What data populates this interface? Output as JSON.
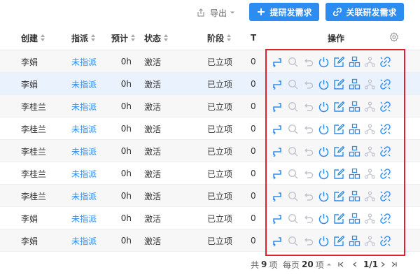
{
  "toolbar": {
    "export_label": "导出",
    "create_label": "提研发需求",
    "link_label": "关联研发需求"
  },
  "table": {
    "headers": {
      "creator": "创建",
      "assign": "指派",
      "estimate": "预计",
      "status": "状态",
      "stage": "阶段",
      "t": "T",
      "actions": "操作"
    },
    "rows": [
      {
        "creator": "李娟",
        "assign": "未指派",
        "estimate": "0h",
        "status": "激活",
        "stage": "已立项",
        "t": "0"
      },
      {
        "creator": "李娟",
        "assign": "未指派",
        "estimate": "0h",
        "status": "激活",
        "stage": "已立项",
        "t": "0"
      },
      {
        "creator": "李桂兰",
        "assign": "未指派",
        "estimate": "0h",
        "status": "激活",
        "stage": "已立项",
        "t": "0"
      },
      {
        "creator": "李桂兰",
        "assign": "未指派",
        "estimate": "0h",
        "status": "激活",
        "stage": "已立项",
        "t": "0"
      },
      {
        "creator": "李桂兰",
        "assign": "未指派",
        "estimate": "0h",
        "status": "激活",
        "stage": "已立项",
        "t": "0"
      },
      {
        "creator": "李桂兰",
        "assign": "未指派",
        "estimate": "0h",
        "status": "激活",
        "stage": "已立项",
        "t": "0"
      },
      {
        "creator": "李桂兰",
        "assign": "未指派",
        "estimate": "0h",
        "status": "激活",
        "stage": "已立项",
        "t": "0"
      },
      {
        "creator": "李娟",
        "assign": "未指派",
        "estimate": "0h",
        "status": "激活",
        "stage": "已立项",
        "t": "0"
      },
      {
        "creator": "李娟",
        "assign": "未指派",
        "estimate": "0h",
        "status": "激活",
        "stage": "已立项",
        "t": "0"
      }
    ],
    "action_icons": [
      "change-icon",
      "search-icon",
      "undo-icon",
      "power-icon",
      "edit-icon",
      "split-icon",
      "branch-icon",
      "unlink-icon"
    ]
  },
  "pager": {
    "total_prefix": "共",
    "total_count": "9",
    "total_suffix": "项",
    "per_page_prefix": "每页",
    "per_page": "20",
    "per_page_suffix": "项",
    "page_info": "1/1"
  },
  "colors": {
    "primary": "#2d8cf0",
    "link": "#2d8cf0",
    "disabled_icon": "#c0c4cc",
    "highlight_border": "#e0202c"
  }
}
